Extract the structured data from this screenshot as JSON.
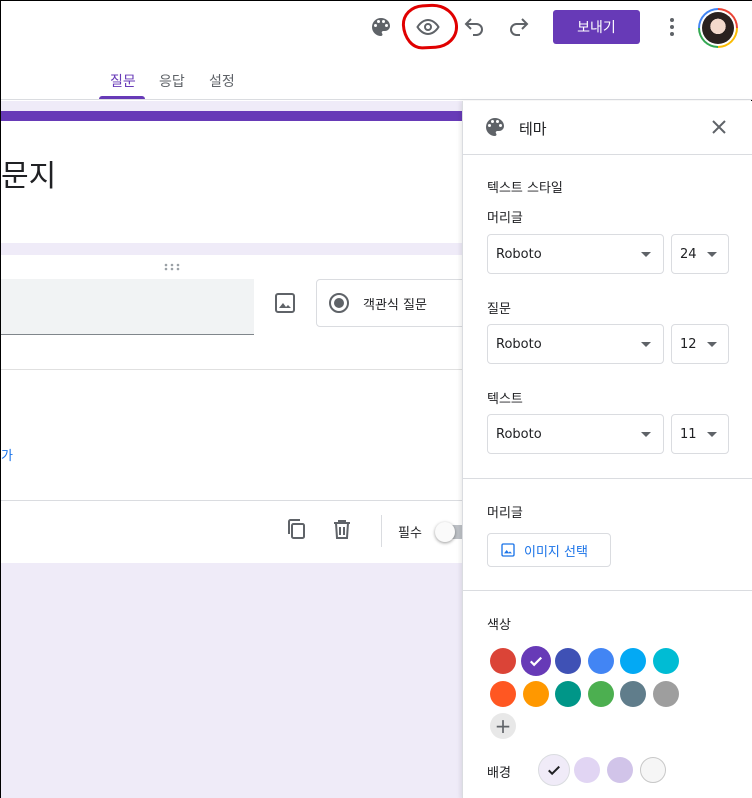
{
  "topbar": {
    "send_label": "보내기",
    "icons": [
      "palette-icon",
      "eye-icon",
      "undo-icon",
      "redo-icon",
      "more-vert-icon"
    ]
  },
  "tabs": [
    {
      "label": "질문",
      "active": true
    },
    {
      "label": "응답",
      "active": false
    },
    {
      "label": "설정",
      "active": false
    }
  ],
  "form": {
    "title": "문지",
    "question_type": "객관식 질문",
    "add_option_text": "가",
    "required_label": "필수",
    "required_on": false
  },
  "theme_panel": {
    "title": "테마",
    "text_style_label": "텍스트 스타일",
    "header_label": "머리글",
    "header_font": "Roboto",
    "header_size": "24",
    "question_label": "질문",
    "question_font": "Roboto",
    "question_size": "12",
    "text_label": "텍스트",
    "text_font": "Roboto",
    "text_size": "11",
    "header_image_label": "머리글",
    "choose_image_label": "이미지 선택",
    "color_label": "색상",
    "colors": [
      "#db4437",
      "#673ab7",
      "#3f51b5",
      "#4285f4",
      "#03a9f4",
      "#00bcd4",
      "#ff5722",
      "#ff9800",
      "#009688",
      "#4caf50",
      "#607d8b",
      "#9e9e9e"
    ],
    "selected_color_index": 1,
    "background_label": "배경",
    "backgrounds": [
      "#f0ebf8",
      "#e1d5f3",
      "#d1c4e9",
      "#f6f6f6"
    ],
    "selected_background_index": 0
  }
}
